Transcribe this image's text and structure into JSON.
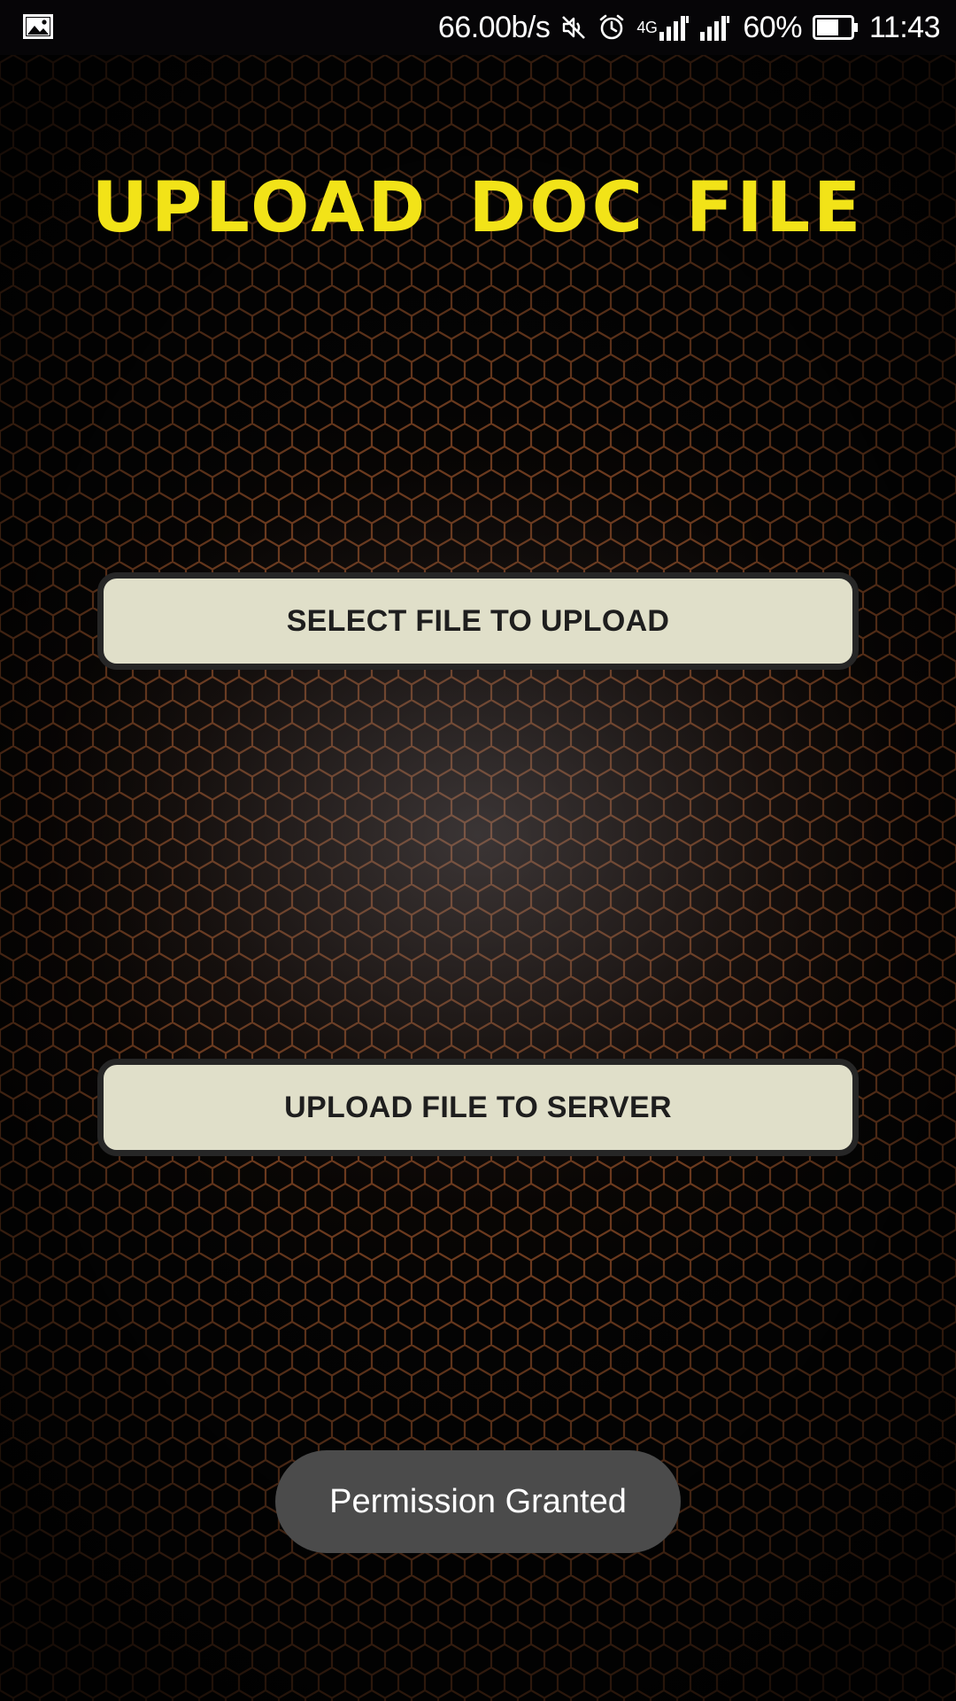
{
  "status_bar": {
    "net_speed": "66.00b/s",
    "network_type": "4G",
    "battery_percent": "60%",
    "time": "11:43",
    "left_icon": "image-icon",
    "icons": [
      "mute-icon",
      "alarm-icon",
      "signal-icon",
      "signal-icon",
      "battery-icon"
    ]
  },
  "main": {
    "title": "UPLOAD DOC FILE",
    "select_button_label": "SELECT FILE TO UPLOAD",
    "upload_button_label": "UPLOAD FILE TO SERVER"
  },
  "toast": {
    "message": "Permission Granted"
  },
  "colors": {
    "title": "#f2e318",
    "button_fill": "#e0dfc9",
    "button_border": "#262626",
    "toast_fill": "#4b4b4b",
    "background": "#050505"
  }
}
